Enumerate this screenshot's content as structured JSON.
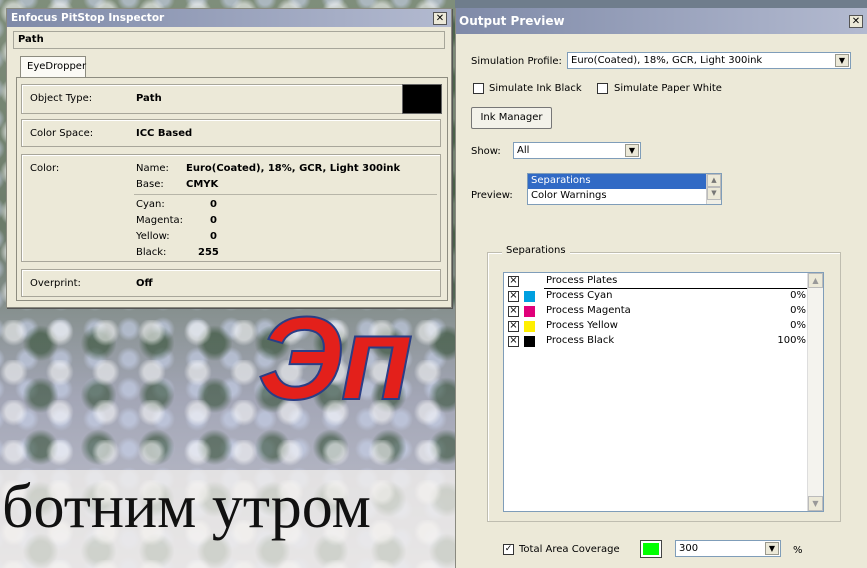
{
  "background": {
    "red_title": "Эп",
    "russian_text": "ботним утром"
  },
  "inspector": {
    "title": "Enfocus PitStop Inspector",
    "close_glyph": "✕",
    "path": "Path",
    "tab": "EyeDropper",
    "object_type_label": "Object Type:",
    "object_type_value": "Path",
    "object_swatch_color": "#000000",
    "color_space_label": "Color Space:",
    "color_space_value": "ICC Based",
    "color_label": "Color:",
    "name_label": "Name:",
    "name_value": "Euro(Coated), 18%, GCR, Light 300ink",
    "base_label": "Base:",
    "base_value": "CMYK",
    "cyan_label": "Cyan:",
    "cyan_value": "0",
    "magenta_label": "Magenta:",
    "magenta_value": "0",
    "yellow_label": "Yellow:",
    "yellow_value": "0",
    "black_label": "Black:",
    "black_value": "255",
    "overprint_label": "Overprint:",
    "overprint_value": "Off"
  },
  "output": {
    "title": "Output Preview",
    "close_glyph": "✕",
    "sim_profile_label": "Simulation Profile:",
    "sim_profile_value": "Euro(Coated), 18%, GCR, Light 300ink",
    "simulate_ink_black_label": "Simulate Ink Black",
    "simulate_ink_black_checked": false,
    "simulate_paper_white_label": "Simulate Paper White",
    "simulate_paper_white_checked": false,
    "ink_manager_label": "Ink Manager",
    "show_label": "Show:",
    "show_value": "All",
    "preview_label": "Preview:",
    "preview_options": [
      "Separations",
      "Color Warnings"
    ],
    "preview_selected": "Separations",
    "separations_legend": "Separations",
    "separations": [
      {
        "name": "Process Plates",
        "color": "",
        "pct": ""
      },
      {
        "name": "Process Cyan",
        "color": "#00a0e0",
        "pct": "0%"
      },
      {
        "name": "Process Magenta",
        "color": "#e0007a",
        "pct": "0%"
      },
      {
        "name": "Process Yellow",
        "color": "#ffef00",
        "pct": "0%"
      },
      {
        "name": "Process Black",
        "color": "#000000",
        "pct": "100%"
      }
    ],
    "tac_label": "Total Area Coverage",
    "tac_checked": true,
    "tac_color": "#00ff00",
    "tac_value": "300",
    "tac_unit": "%"
  }
}
